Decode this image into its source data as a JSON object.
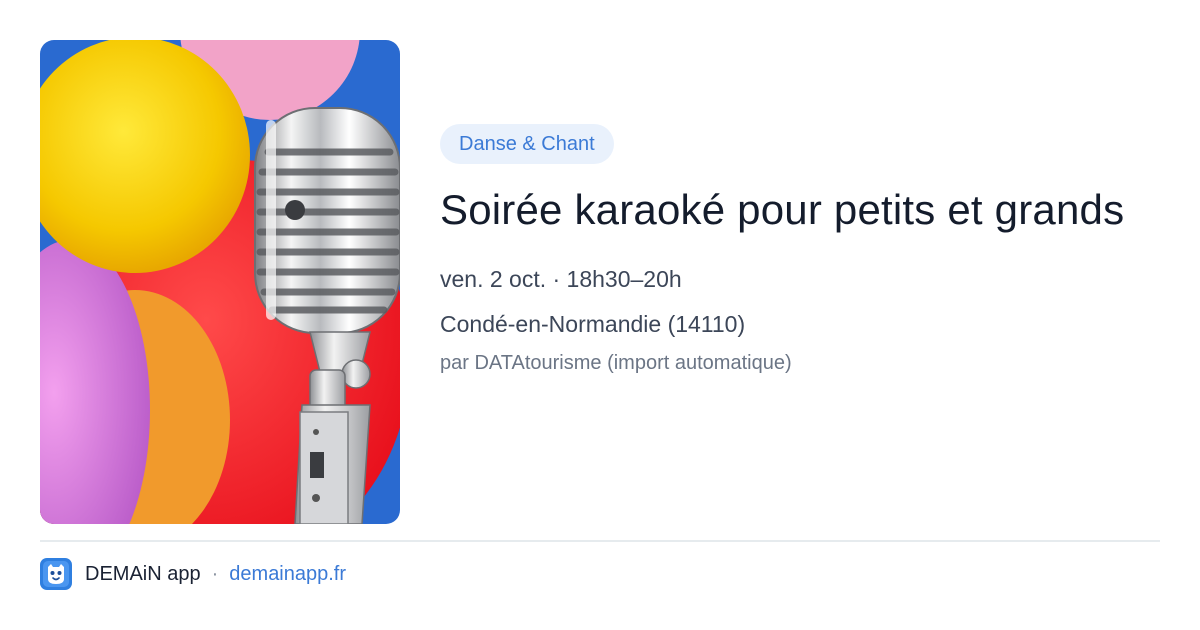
{
  "event": {
    "image": {
      "subject": "vintage-microphone",
      "background_colors": [
        "#f7d600",
        "#ff2b36",
        "#2a6ad0",
        "#e07bd8",
        "#f49a2b"
      ]
    },
    "category": "Danse & Chant",
    "title": "Soirée karaoké pour petits et grands",
    "date_time": "ven. 2 oct. · 18h30–20h",
    "location": "Condé-en-Normandie (14110)",
    "source": "par DATAtourisme (import automatique)"
  },
  "footer": {
    "app_name": "DEMAiN app",
    "separator": "·",
    "link": "demainapp.fr",
    "logo_icon": "demain-app-logo-icon"
  },
  "colors": {
    "accent": "#3b7ad6",
    "badge_bg": "#e9f1fc",
    "title": "#141c2c",
    "muted": "#6b7585"
  }
}
